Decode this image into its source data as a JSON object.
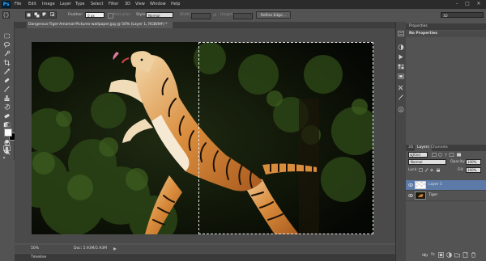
{
  "app": {
    "logo": "Ps"
  },
  "menu": [
    "File",
    "Edit",
    "Image",
    "Layer",
    "Type",
    "Select",
    "Filter",
    "3D",
    "View",
    "Window",
    "Help"
  ],
  "window_controls": {
    "minimize": "–",
    "maximize": "□",
    "close": "✕"
  },
  "options": {
    "feather_label": "Feather:",
    "feather_value": "0 px",
    "antialias_label": "Anti-alias",
    "style_label": "Style:",
    "style_value": "Normal",
    "width_label": "Width:",
    "height_label": "Height:",
    "refine_edge": "Refine Edge...",
    "workspace": "3D"
  },
  "document": {
    "tab_title": "Dangerous-Tiger-Amamal-Pictures-wallpaper.jpg @ 50% (Layer 1, RGB/8#) *",
    "zoom": "50%",
    "doc_size": "Doc: 5.93M/5.93M"
  },
  "timeline": {
    "label": "Timeline"
  },
  "panels": {
    "properties_tab": "Properties",
    "properties_body": "No Properties",
    "tabs": [
      "3D",
      "Layers",
      "Channels"
    ],
    "kind": "Kind",
    "blend_mode": "Normal",
    "opacity_label": "Opacity:",
    "opacity_value": "100%",
    "lock_label": "Lock:",
    "fill_label": "Fill:",
    "fill_value": "100%",
    "layers": [
      {
        "name": "Layer 1",
        "selected": true
      },
      {
        "name": "Tiger",
        "selected": false
      }
    ]
  },
  "colors": {
    "foreground": "#ffffff",
    "background": "#000000",
    "selected_layer": "#5b7aa8"
  }
}
